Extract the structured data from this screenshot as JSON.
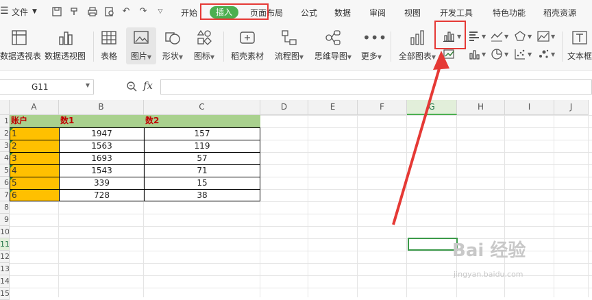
{
  "menubar": {
    "menu_icon": "hamburger-icon",
    "file_label": "文件",
    "tabs": [
      "开始",
      "插入",
      "页面布局",
      "公式",
      "数据",
      "审阅",
      "视图",
      "开发工具",
      "特色功能",
      "稻壳资源"
    ],
    "active_tab": "插入"
  },
  "ribbon": {
    "pivot_table": "数据透视表",
    "pivot_chart": "数据透视图",
    "table": "表格",
    "picture": "图片",
    "shape": "形状",
    "icon": "图标",
    "docer_material": "稻壳素材",
    "flowchart": "流程图",
    "mindmap": "思维导图",
    "more": "更多",
    "all_charts": "全部图表",
    "textbox": "文本框"
  },
  "formula_bar": {
    "name_box": "G11",
    "fx_label": "fx",
    "value": ""
  },
  "sheet": {
    "columns": [
      "A",
      "B",
      "C",
      "D",
      "E",
      "F",
      "G",
      "H",
      "I",
      "J"
    ],
    "selected_column": "G",
    "selected_row": "11",
    "rows": [
      "1",
      "2",
      "3",
      "4",
      "5",
      "6",
      "7",
      "8",
      "9",
      "10",
      "11",
      "12",
      "13",
      "14",
      "15"
    ],
    "table": {
      "headers": [
        "账户",
        "数1",
        "数2"
      ],
      "data": [
        [
          "1",
          "1947",
          "157"
        ],
        [
          "2",
          "1563",
          "119"
        ],
        [
          "3",
          "1693",
          "57"
        ],
        [
          "4",
          "1543",
          "71"
        ],
        [
          "5",
          "339",
          "15"
        ],
        [
          "6",
          "728",
          "38"
        ]
      ]
    }
  },
  "colors": {
    "accent_green": "#4caf50",
    "header_fill": "#a9d18e",
    "account_fill": "#ffc000",
    "annotation_red": "#e53935"
  },
  "watermark": {
    "brand": "Bai 经验",
    "url": "jingyan.baidu.com"
  }
}
